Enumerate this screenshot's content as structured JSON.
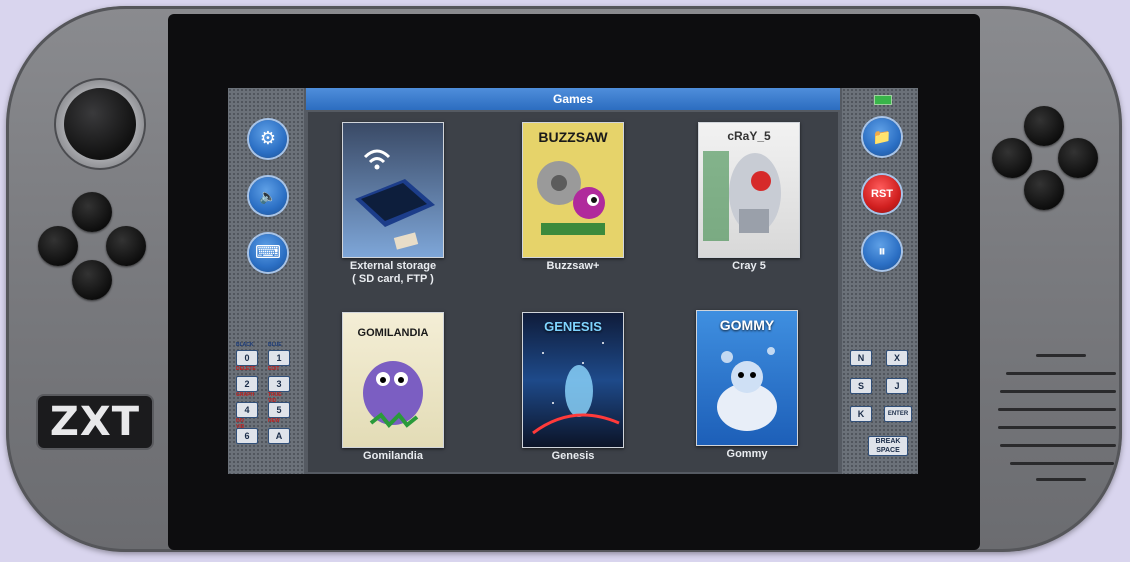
{
  "device": {
    "logo": "ZXT"
  },
  "screen": {
    "title": "Games",
    "left_buttons": [
      {
        "name": "settings",
        "icon": "gear-icon",
        "glyph": "⚙"
      },
      {
        "name": "sound",
        "icon": "speaker-icon",
        "glyph": "🔈"
      },
      {
        "name": "keyboard",
        "icon": "keyboard-icon",
        "glyph": "⌨"
      }
    ],
    "right_buttons": [
      {
        "name": "folder",
        "icon": "folder-icon",
        "glyph": "📁"
      },
      {
        "name": "reset",
        "label": "RST"
      },
      {
        "name": "pause",
        "icon": "pause-icon",
        "glyph": "⏸"
      }
    ],
    "games": [
      {
        "label_line1": "External storage",
        "label_line2": "( SD card, FTP )",
        "cover_title": ""
      },
      {
        "label_line1": "Buzzsaw+",
        "label_line2": "",
        "cover_title": "BUZZSAW"
      },
      {
        "label_line1": "Cray 5",
        "label_line2": "",
        "cover_title": "cRaY_5"
      },
      {
        "label_line1": "Gomilandia",
        "label_line2": "",
        "cover_title": "GOMILANDIA"
      },
      {
        "label_line1": "Genesis",
        "label_line2": "",
        "cover_title": "GENESIS"
      },
      {
        "label_line1": "Gommy",
        "label_line2": "",
        "cover_title": "GOMMY"
      }
    ],
    "left_keys": [
      "0",
      "1",
      "2",
      "3",
      "4",
      "5",
      "6",
      "A"
    ],
    "right_keys": [
      "N",
      "X",
      "S",
      "J",
      "K",
      "ENTER"
    ],
    "space_key": "SPACE",
    "break_label": "BREAK"
  },
  "colors": {
    "title_bar": "#2c6dc0",
    "button_blue": "#2b6fc4",
    "button_red": "#d01f1f",
    "body": "#7a7b7f"
  }
}
